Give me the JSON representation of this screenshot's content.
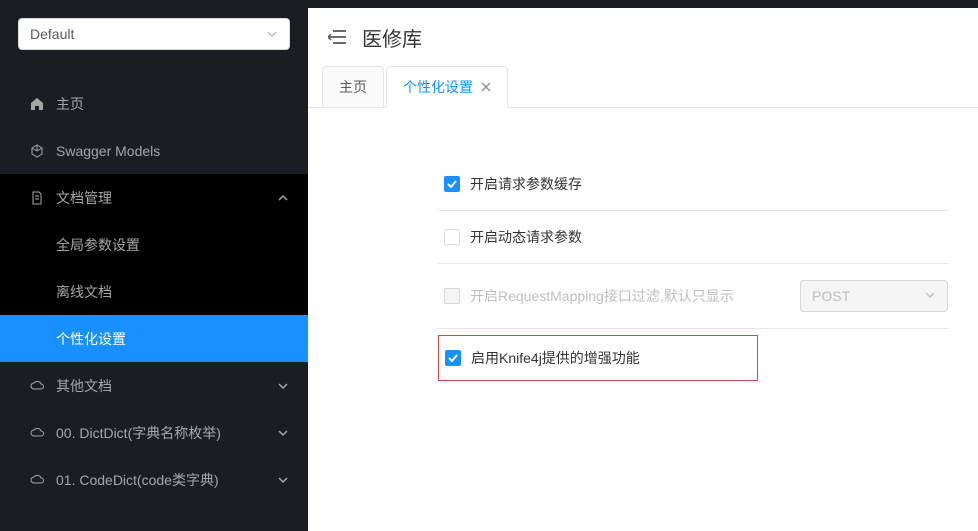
{
  "selector": {
    "value": "Default"
  },
  "sidebar": {
    "items": [
      {
        "label": "主页"
      },
      {
        "label": "Swagger Models"
      },
      {
        "label": "文档管理",
        "open": true,
        "children": [
          {
            "label": "全局参数设置"
          },
          {
            "label": "离线文档"
          },
          {
            "label": "个性化设置",
            "active": true
          }
        ]
      },
      {
        "label": "其他文档"
      },
      {
        "label": "00. DictDict(字典名称枚举)"
      },
      {
        "label": "01. CodeDict(code类字典)"
      }
    ]
  },
  "header": {
    "title": "医修库"
  },
  "tabs": [
    {
      "label": "主页",
      "closable": false
    },
    {
      "label": "个性化设置",
      "closable": true,
      "active": true
    }
  ],
  "settings": {
    "cacheParams": {
      "label": "开启请求参数缓存",
      "checked": true
    },
    "dynamicParams": {
      "label": "开启动态请求参数",
      "checked": false
    },
    "requestMappingFilter": {
      "label": "开启RequestMapping接口过滤,默认只显示",
      "checked": false,
      "selectValue": "POST"
    },
    "knife4jEnhance": {
      "label": "启用Knife4j提供的增强功能",
      "checked": true
    }
  }
}
